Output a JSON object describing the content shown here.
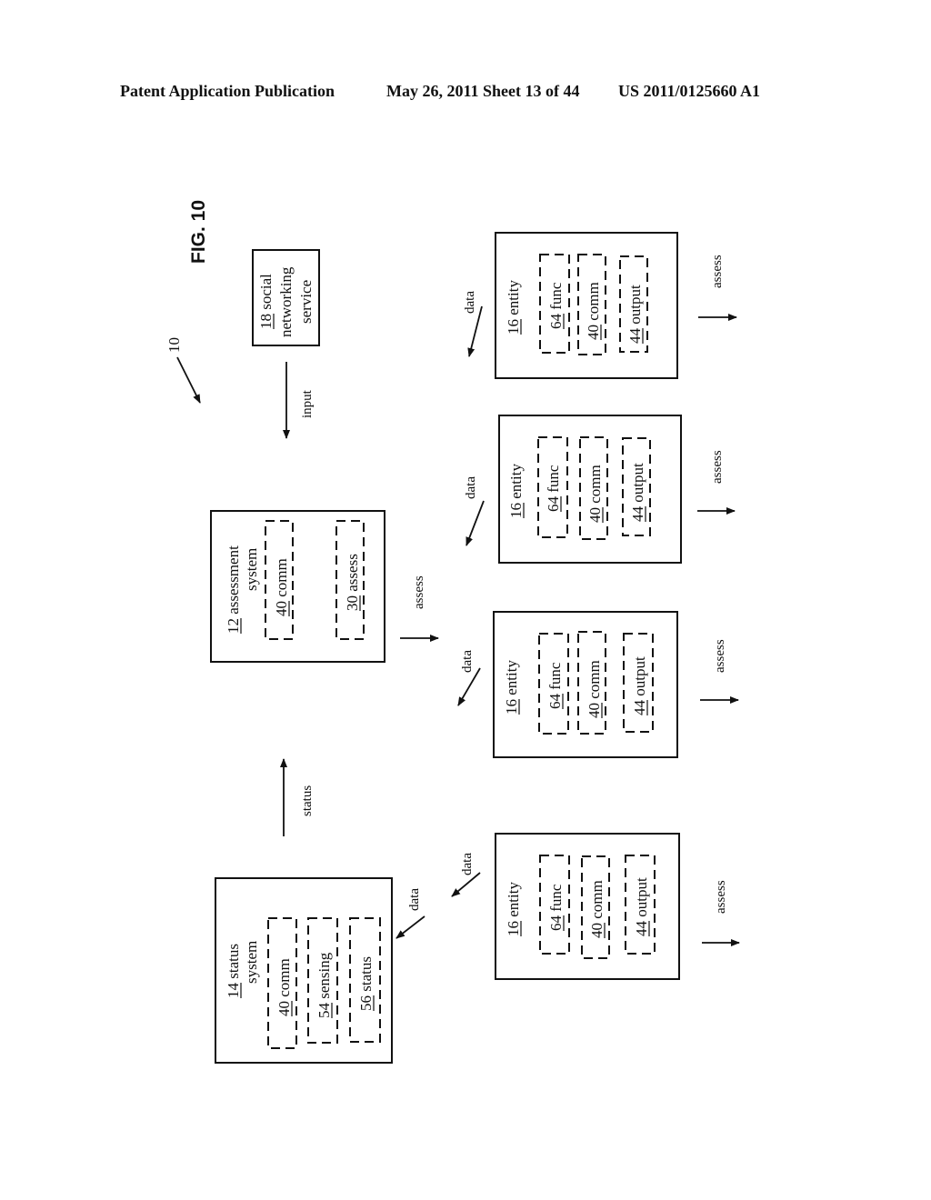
{
  "header": {
    "left": "Patent Application Publication",
    "middle": "May 26, 2011  Sheet 13 of 44",
    "right": "US 2011/0125660 A1"
  },
  "figure": {
    "title": "FIG. 10",
    "system_ref": "10",
    "social": {
      "num": "18",
      "line1": " social",
      "line2": "networking",
      "line3": "service"
    },
    "input_label": "input",
    "assessment": {
      "num": "12",
      "line1": " assessment",
      "line2": "system",
      "modules": [
        {
          "num": "40",
          "label": " comm"
        },
        {
          "num": "30",
          "label": " assess"
        }
      ]
    },
    "assess_arrow_label": "assess",
    "status_arrow_label": "status",
    "status_system": {
      "num": "14",
      "line1": " status",
      "line2": "system",
      "modules": [
        {
          "num": "40",
          "label": " comm"
        },
        {
          "num": "54",
          "label": " sensing"
        },
        {
          "num": "56",
          "label": " status"
        }
      ]
    },
    "entities": [
      {
        "num": "16",
        "label": " entity",
        "data_label": "data",
        "assess_label": "assess",
        "modules": [
          {
            "num": "64",
            "label": " func"
          },
          {
            "num": "40",
            "label": " comm"
          },
          {
            "num": "44",
            "label": " output"
          }
        ]
      },
      {
        "num": "16",
        "label": " entity",
        "data_label": "data",
        "assess_label": "assess",
        "modules": [
          {
            "num": "64",
            "label": " func"
          },
          {
            "num": "40",
            "label": " comm"
          },
          {
            "num": "44",
            "label": " output"
          }
        ]
      },
      {
        "num": "16",
        "label": " entity",
        "data_label": "data",
        "assess_label": "assess",
        "modules": [
          {
            "num": "64",
            "label": " func"
          },
          {
            "num": "40",
            "label": " comm"
          },
          {
            "num": "44",
            "label": " output"
          }
        ]
      },
      {
        "num": "16",
        "label": " entity",
        "data_label": "data",
        "assess_label": "assess",
        "modules": [
          {
            "num": "64",
            "label": " func"
          },
          {
            "num": "40",
            "label": " comm"
          },
          {
            "num": "44",
            "label": " output"
          }
        ]
      }
    ],
    "status_data_label": "data"
  }
}
